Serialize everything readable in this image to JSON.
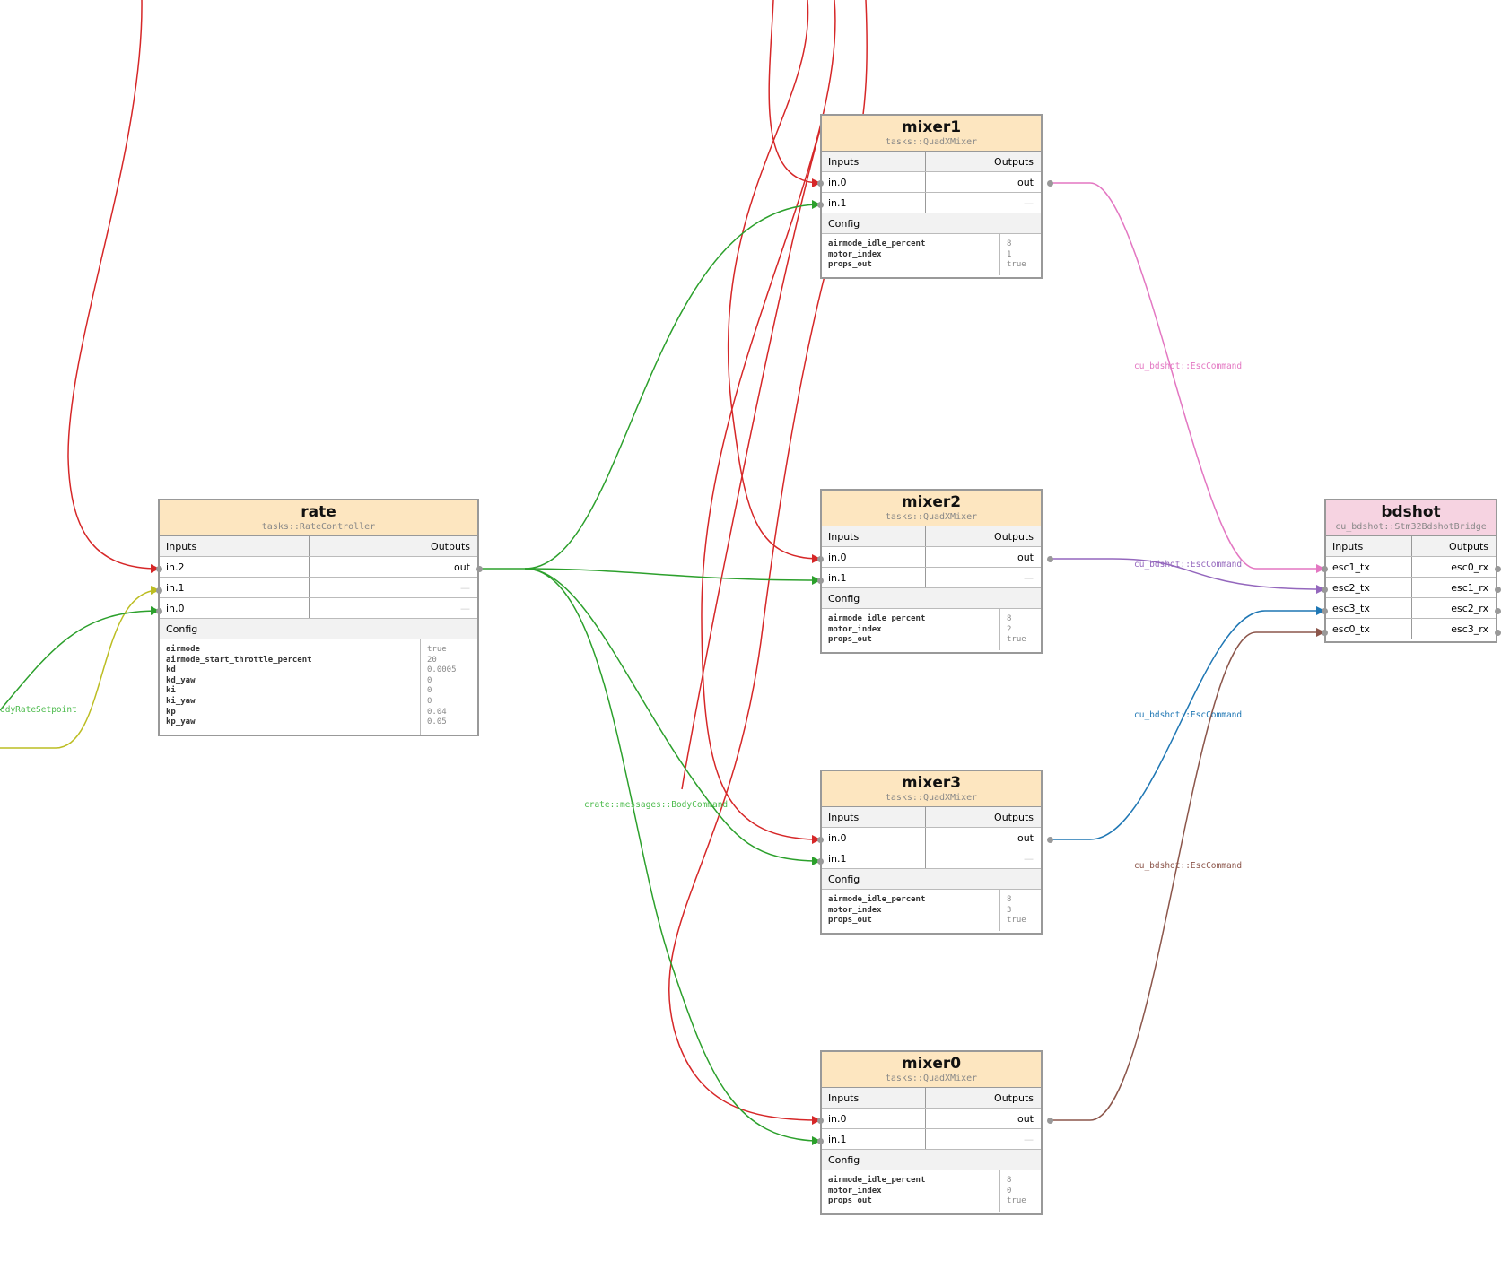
{
  "nodes": {
    "rate": {
      "title": "rate",
      "type": "tasks::RateController",
      "inputs_header": "Inputs",
      "outputs_header": "Outputs",
      "rows": [
        {
          "in": "in.2",
          "out": "out"
        },
        {
          "in": "in.1",
          "out": "—"
        },
        {
          "in": "in.0",
          "out": "—"
        }
      ],
      "config_header": "Config",
      "config": [
        {
          "key": "airmode",
          "value": "true"
        },
        {
          "key": "airmode_start_throttle_percent",
          "value": "20"
        },
        {
          "key": "kd",
          "value": "0.0005"
        },
        {
          "key": "kd_yaw",
          "value": "0"
        },
        {
          "key": "ki",
          "value": "0"
        },
        {
          "key": "ki_yaw",
          "value": "0"
        },
        {
          "key": "kp",
          "value": "0.04"
        },
        {
          "key": "kp_yaw",
          "value": "0.05"
        }
      ]
    },
    "mixer1": {
      "title": "mixer1",
      "type": "tasks::QuadXMixer",
      "inputs_header": "Inputs",
      "outputs_header": "Outputs",
      "rows": [
        {
          "in": "in.0",
          "out": "out"
        },
        {
          "in": "in.1",
          "out": "—"
        }
      ],
      "config_header": "Config",
      "config": [
        {
          "key": "airmode_idle_percent",
          "value": "8"
        },
        {
          "key": "motor_index",
          "value": "1"
        },
        {
          "key": "props_out",
          "value": "true"
        }
      ]
    },
    "mixer2": {
      "title": "mixer2",
      "type": "tasks::QuadXMixer",
      "inputs_header": "Inputs",
      "outputs_header": "Outputs",
      "rows": [
        {
          "in": "in.0",
          "out": "out"
        },
        {
          "in": "in.1",
          "out": "—"
        }
      ],
      "config_header": "Config",
      "config": [
        {
          "key": "airmode_idle_percent",
          "value": "8"
        },
        {
          "key": "motor_index",
          "value": "2"
        },
        {
          "key": "props_out",
          "value": "true"
        }
      ]
    },
    "mixer3": {
      "title": "mixer3",
      "type": "tasks::QuadXMixer",
      "inputs_header": "Inputs",
      "outputs_header": "Outputs",
      "rows": [
        {
          "in": "in.0",
          "out": "out"
        },
        {
          "in": "in.1",
          "out": "—"
        }
      ],
      "config_header": "Config",
      "config": [
        {
          "key": "airmode_idle_percent",
          "value": "8"
        },
        {
          "key": "motor_index",
          "value": "3"
        },
        {
          "key": "props_out",
          "value": "true"
        }
      ]
    },
    "mixer0": {
      "title": "mixer0",
      "type": "tasks::QuadXMixer",
      "inputs_header": "Inputs",
      "outputs_header": "Outputs",
      "rows": [
        {
          "in": "in.0",
          "out": "out"
        },
        {
          "in": "in.1",
          "out": "—"
        }
      ],
      "config_header": "Config",
      "config": [
        {
          "key": "airmode_idle_percent",
          "value": "8"
        },
        {
          "key": "motor_index",
          "value": "0"
        },
        {
          "key": "props_out",
          "value": "true"
        }
      ]
    },
    "bdshot": {
      "title": "bdshot",
      "type": "cu_bdshot::Stm32BdshotBridge",
      "inputs_header": "Inputs",
      "outputs_header": "Outputs",
      "rows": [
        {
          "in": "esc1_tx",
          "out": "esc0_rx"
        },
        {
          "in": "esc2_tx",
          "out": "esc1_rx"
        },
        {
          "in": "esc3_tx",
          "out": "esc2_rx"
        },
        {
          "in": "esc0_tx",
          "out": "esc3_rx"
        }
      ]
    }
  },
  "edge_labels": {
    "body_rate_setpoint": "odyRateSetpoint",
    "body_command": "crate::messages::BodyCommand",
    "esc_cmd_1": "cu_bdshot::EscCommand",
    "esc_cmd_2": "cu_bdshot::EscCommand",
    "esc_cmd_3": "cu_bdshot::EscCommand",
    "esc_cmd_0": "cu_bdshot::EscCommand"
  },
  "colors": {
    "red": "#d62728",
    "green": "#2ca02c",
    "olive": "#bcbd22",
    "pink": "#e377c2",
    "purple": "#9467bd",
    "blue": "#1f77b4",
    "brown": "#8c564b",
    "label_green": "#4cbb4c"
  }
}
